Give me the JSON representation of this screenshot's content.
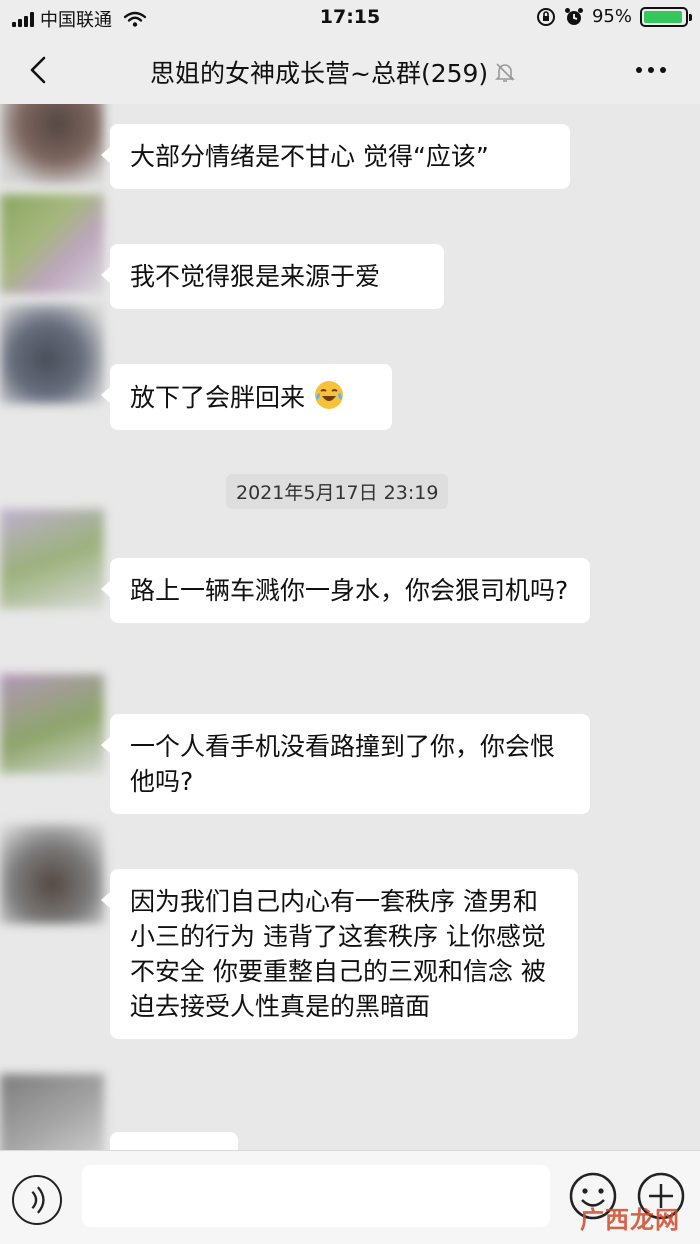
{
  "status_bar": {
    "carrier": "中国联通",
    "time": "17:15",
    "battery_percent": "95%",
    "battery_level": 0.95
  },
  "nav": {
    "title": "思姐的女神成长营~总群(259)",
    "back_icon": "chevron-left-icon",
    "more_icon": "ellipsis-icon",
    "mute_icon": "bell-muted-icon"
  },
  "messages": [
    {
      "text": "大部分情绪是不甘心 觉得“应该”"
    },
    {
      "text": "我不觉得狠是来源于爱"
    },
    {
      "text": "放下了会胖回来",
      "emoji": "face-with-tears-of-joy"
    },
    {
      "text": "路上一辆车溅你一身水，你会狠司机吗?"
    },
    {
      "text": "一个人看手机没看路撞到了你，你会恨他吗?"
    },
    {
      "text": "因为我们自己内心有一套秩序 渣男和小三的行为 违背了这套秩序 让你感觉不安全 你要重整自己的三观和信念 被迫去接受人性真是的黑暗面"
    }
  ],
  "timestamp": "2021年5月17日 23:19",
  "input_bar": {
    "placeholder": "",
    "voice_icon": "voice-icon",
    "emoji_icon": "smiley-icon",
    "plus_icon": "plus-circle-icon"
  },
  "watermark": "广西龙网",
  "colors": {
    "chat_background": "#e8e8e8",
    "bubble": "#ffffff",
    "battery": "#34c759",
    "watermark": "#d04a2a"
  }
}
